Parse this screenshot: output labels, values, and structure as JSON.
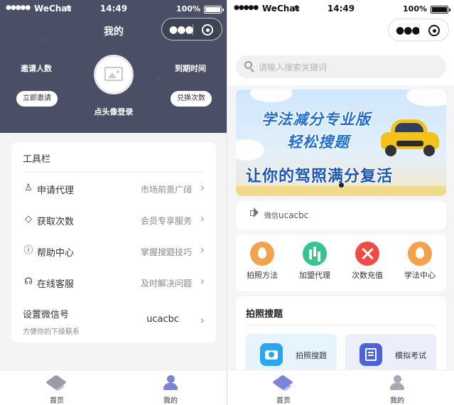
{
  "status_bar": {
    "carrier": "WeChat",
    "time": "14:49",
    "battery": "100%"
  },
  "profile": {
    "title": "我的",
    "invite_count_label": "邀请人数",
    "expire_label": "到期时间",
    "invite_button": "立即邀请",
    "redeem_button": "兑换次数",
    "login_text": "点头像登录",
    "toolbar": {
      "title": "工具栏",
      "items": [
        {
          "icon": "person-icon",
          "label": "申请代理",
          "hint": "市场前景广阔"
        },
        {
          "icon": "diamond-icon",
          "label": "获取次数",
          "hint": "会员专享服务"
        },
        {
          "icon": "alert-circle-icon",
          "label": "帮助中心",
          "hint": "掌握搜题技巧"
        },
        {
          "icon": "headset-icon",
          "label": "在线客服",
          "hint": "及时解决问题"
        }
      ],
      "wechat": {
        "label": "设置微信号",
        "sub": "方便你的下级联系",
        "value": "ucacbc"
      }
    }
  },
  "home": {
    "search_placeholder": "请输入搜索关键词",
    "banner": {
      "line1": "学法减分专业版",
      "line2": "轻松搜题",
      "line3": "让你的驾照满分复活"
    },
    "notice": {
      "prefix": "微信",
      "value": "ucacbc"
    },
    "grid": [
      {
        "icon": "fire-icon",
        "label": "拍照方法",
        "color": "#f5a04a"
      },
      {
        "icon": "bar-chart-icon",
        "label": "加盟代理",
        "color": "#35c48c"
      },
      {
        "icon": "tools-icon",
        "label": "次数充值",
        "color": "#ee4c45"
      },
      {
        "icon": "fire-icon",
        "label": "学法中心",
        "color": "#f5a04a"
      }
    ],
    "photo_search": {
      "title": "拍照搜题",
      "features": [
        {
          "icon": "camera-icon",
          "label": "拍照搜题",
          "color": "#2aa7ec",
          "bg": "#e6f4fd"
        },
        {
          "icon": "exam-icon",
          "label": "模拟考试",
          "color": "#4b63d6",
          "bg": "#eceefb"
        }
      ]
    }
  },
  "tabbar": {
    "home": "首页",
    "me": "我的"
  },
  "colors": {
    "header_bg": "#4a4f66",
    "accent": "#7b84d6"
  }
}
